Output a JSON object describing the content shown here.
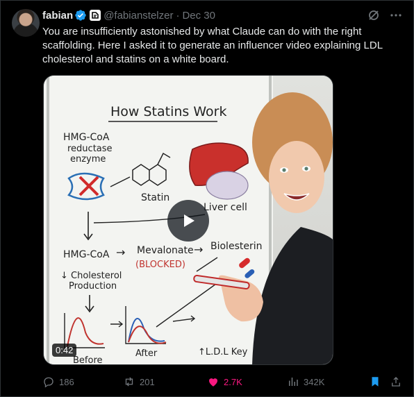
{
  "author": {
    "name": "fabian",
    "handle": "@fabianstelzer",
    "separator": "·",
    "date": "Dec 30"
  },
  "tweet": {
    "text": "You are insufficiently astonished by what Claude can do with the right scaffolding. Here I asked it to generate an influencer video explaining LDL cholesterol and statins on a white board."
  },
  "video": {
    "duration": "0:42",
    "board": {
      "title": "How Statins Work",
      "enzyme": [
        "HMG-CoA",
        "reductase",
        "enzyme"
      ],
      "statin": "Statin",
      "liver": "Liver cell",
      "hmg": "HMG-CoA",
      "arrow": "→",
      "mevalonate": "Mevalonate",
      "blocked": "(BLOCKED)",
      "biolesterin": "Biolesterin",
      "chol": [
        "↓ Cholesterol",
        "Production"
      ],
      "before": "Before",
      "after": "After",
      "ldl": "↑L.D.L Key"
    }
  },
  "actions": {
    "replies": "186",
    "reposts": "201",
    "likes": "2.7K",
    "views": "342K"
  },
  "colors": {
    "like": "#f91880",
    "bookmark": "#1d9bf0",
    "verified": "#1d9bf0",
    "muted": "#71767b"
  }
}
